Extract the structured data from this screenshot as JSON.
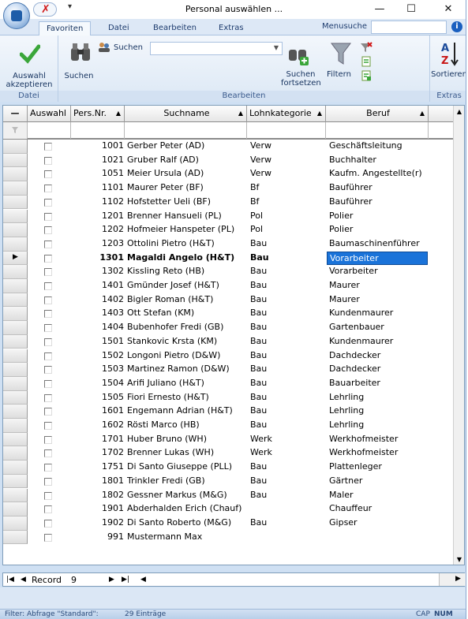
{
  "window": {
    "title": "Personal auswählen ...",
    "minimize": "—",
    "maximize": "☐",
    "close": "✕"
  },
  "ribbon_tabs": {
    "favoriten": "Favoriten",
    "datei": "Datei",
    "bearbeiten": "Bearbeiten",
    "extras": "Extras",
    "menusuche": "Menusuche"
  },
  "ribbon": {
    "auswahl_label_1": "Auswahl",
    "auswahl_label_2": "akzeptieren",
    "group_datei": "Datei",
    "suchen_big": "Suchen",
    "suchen_small": "Suchen",
    "search_value": "",
    "suchen_fortsetzen_1": "Suchen",
    "suchen_fortsetzen_2": "fortsetzen",
    "filtern": "Filtern",
    "group_bearbeiten": "Bearbeiten",
    "sortieren": "Sortieren",
    "group_extras": "Extras"
  },
  "grid": {
    "headers": {
      "auswahl": "Auswahl",
      "persnr": "Pers.Nr.",
      "suchname": "Suchname",
      "lohn": "Lohnkategorie",
      "beruf": "Beruf"
    },
    "rows": [
      {
        "nr": "1001",
        "name": "Gerber Peter (AD)",
        "lohn": "Verw",
        "beruf": "Geschäftsleitung"
      },
      {
        "nr": "1021",
        "name": "Gruber Ralf (AD)",
        "lohn": "Verw",
        "beruf": "Buchhalter"
      },
      {
        "nr": "1051",
        "name": "Meier Ursula (AD)",
        "lohn": "Verw",
        "beruf": "Kaufm. Angestellte(r)"
      },
      {
        "nr": "1101",
        "name": "Maurer Peter (BF)",
        "lohn": "Bf",
        "beruf": "Bauführer"
      },
      {
        "nr": "1102",
        "name": "Hofstetter Ueli (BF)",
        "lohn": "Bf",
        "beruf": "Bauführer"
      },
      {
        "nr": "1201",
        "name": "Brenner Hansueli (PL)",
        "lohn": "Pol",
        "beruf": "Polier"
      },
      {
        "nr": "1202",
        "name": "Hofmeier Hanspeter (PL)",
        "lohn": "Pol",
        "beruf": "Polier"
      },
      {
        "nr": "1203",
        "name": "Ottolini Pietro (H&T)",
        "lohn": "Bau",
        "beruf": "Baumaschinenführer"
      },
      {
        "nr": "1301",
        "name": "Magaldi Angelo (H&T)",
        "lohn": "Bau",
        "beruf": "Vorarbeiter"
      },
      {
        "nr": "1302",
        "name": "Kissling Reto (HB)",
        "lohn": "Bau",
        "beruf": "Vorarbeiter"
      },
      {
        "nr": "1401",
        "name": "Gmünder Josef (H&T)",
        "lohn": "Bau",
        "beruf": "Maurer"
      },
      {
        "nr": "1402",
        "name": "Bigler Roman (H&T)",
        "lohn": "Bau",
        "beruf": "Maurer"
      },
      {
        "nr": "1403",
        "name": "Ott Stefan (KM)",
        "lohn": "Bau",
        "beruf": "Kundenmaurer"
      },
      {
        "nr": "1404",
        "name": "Bubenhofer Fredi (GB)",
        "lohn": "Bau",
        "beruf": "Gartenbauer"
      },
      {
        "nr": "1501",
        "name": "Stankovic Krsta (KM)",
        "lohn": "Bau",
        "beruf": "Kundenmaurer"
      },
      {
        "nr": "1502",
        "name": "Longoni Pietro (D&W)",
        "lohn": "Bau",
        "beruf": "Dachdecker"
      },
      {
        "nr": "1503",
        "name": "Martinez Ramon (D&W)",
        "lohn": "Bau",
        "beruf": "Dachdecker"
      },
      {
        "nr": "1504",
        "name": "Arifi Juliano (H&T)",
        "lohn": "Bau",
        "beruf": "Bauarbeiter"
      },
      {
        "nr": "1505",
        "name": "Fiori Ernesto (H&T)",
        "lohn": "Bau",
        "beruf": "Lehrling"
      },
      {
        "nr": "1601",
        "name": "Engemann Adrian (H&T)",
        "lohn": "Bau",
        "beruf": "Lehrling"
      },
      {
        "nr": "1602",
        "name": "Rösti Marco (HB)",
        "lohn": "Bau",
        "beruf": "Lehrling"
      },
      {
        "nr": "1701",
        "name": "Huber Bruno (WH)",
        "lohn": "Werk",
        "beruf": "Werkhofmeister"
      },
      {
        "nr": "1702",
        "name": "Brenner Lukas (WH)",
        "lohn": "Werk",
        "beruf": "Werkhofmeister"
      },
      {
        "nr": "1751",
        "name": "Di Santo Giuseppe (PLL)",
        "lohn": "Bau",
        "beruf": "Plattenleger"
      },
      {
        "nr": "1801",
        "name": "Trinkler Fredi (GB)",
        "lohn": "Bau",
        "beruf": "Gärtner"
      },
      {
        "nr": "1802",
        "name": "Gessner Markus (M&G)",
        "lohn": "Bau",
        "beruf": "Maler"
      },
      {
        "nr": "1901",
        "name": "Abderhalden Erich (Chauf)",
        "lohn": "",
        "beruf": "Chauffeur"
      },
      {
        "nr": "1902",
        "name": "Di Santo Roberto (M&G)",
        "lohn": "Bau",
        "beruf": "Gipser"
      },
      {
        "nr": "991",
        "name": "Mustermann Max",
        "lohn": "",
        "beruf": ""
      }
    ],
    "current_row_index": 8
  },
  "navigator": {
    "record_label": "Record",
    "record_value": "9"
  },
  "status": {
    "filter": "Filter: Abfrage \"Standard\":",
    "count": "29 Einträge",
    "caps": "CAP",
    "num": "NUM"
  },
  "colors": {
    "selection": "#1a73d9",
    "ribbon": "#dce8f5"
  }
}
